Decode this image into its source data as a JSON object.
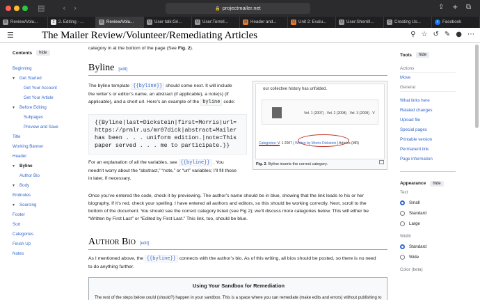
{
  "browser": {
    "url": "projectmailer.net",
    "tabs": [
      {
        "label": "Review/Volu...",
        "favicon": "R",
        "active": false
      },
      {
        "label": "2. Editing - ...",
        "favicon": "2",
        "active": false
      },
      {
        "label": "Review/Volu...",
        "favicon": "R",
        "active": true
      },
      {
        "label": "User talk:Gri...",
        "favicon": "U",
        "active": false
      },
      {
        "label": "User:Terrell...",
        "favicon": "U",
        "active": false
      },
      {
        "label": "Header and...",
        "favicon": "H",
        "active": false
      },
      {
        "label": "Unit 2: Evalu...",
        "favicon": "U",
        "active": false
      },
      {
        "label": "User:SherrilI...",
        "favicon": "U",
        "active": false
      },
      {
        "label": "Creating Us...",
        "favicon": "C",
        "active": false
      },
      {
        "label": "Facebook",
        "favicon": "f",
        "active": false
      }
    ]
  },
  "header": {
    "title_prefix": "The Mailer Review/Volunteer/",
    "title_page": "Remediating Articles"
  },
  "toc": {
    "title": "Contents",
    "hide_label": "hide",
    "items": [
      {
        "label": "Beginning",
        "level": 0
      },
      {
        "label": "Get Started",
        "level": 0,
        "caret": true
      },
      {
        "label": "Get Your Account",
        "level": 2
      },
      {
        "label": "Get Your Article",
        "level": 2
      },
      {
        "label": "Before Editing",
        "level": 0,
        "caret": true
      },
      {
        "label": "Subpages",
        "level": 2
      },
      {
        "label": "Preview and Save",
        "level": 2
      },
      {
        "label": "Title",
        "level": 0
      },
      {
        "label": "Working Banner",
        "level": 0
      },
      {
        "label": "Header",
        "level": 0
      },
      {
        "label": "Byline",
        "level": 0,
        "caret": true,
        "current": true
      },
      {
        "label": "Author Bio",
        "level": 1
      },
      {
        "label": "Body",
        "level": 0,
        "caret": true
      },
      {
        "label": "Endnotes",
        "level": 0
      },
      {
        "label": "Sourcing",
        "level": 0,
        "caret": true
      },
      {
        "label": "Footer",
        "level": 0
      },
      {
        "label": "Sort",
        "level": 0
      },
      {
        "label": "Categories",
        "level": 0
      },
      {
        "label": "Finish Up",
        "level": 0
      },
      {
        "label": "Notes",
        "level": 0
      }
    ]
  },
  "content": {
    "intro_tail_a": "category in at the bottom of the page (See ",
    "intro_tail_fig": "Fig. 2",
    "intro_tail_b": ").",
    "byline_heading": "Byline",
    "edit_label": "[edit]",
    "byline_p1_a": "The byline template ",
    "byline_code": "{{byline}}",
    "byline_p1_b": " should come next. It will include",
    "byline_p1_c": "the writer’s or editor’s name, an abstract (if applicable), a note(s) (if",
    "byline_p1_d": "applicable), and a short url. Here’s an example of the ",
    "byline_plain": "byline",
    "byline_p1_e": " code:",
    "pre_line1": "{{Byline|last=Dickstein|first=Morris|url=",
    "pre_line2": "https://prmlr.us/mr07dick|abstract=Mailer",
    "pre_line3": "has been . . . uniform edition.|note=This",
    "pre_line4": "paper served . . . me to participate.}}",
    "expl_a": "For an explanation of all the variables, see ",
    "expl_b": " . You",
    "expl_c": "needn’t worry about the “abstract,” “note,” or “url” variables; I’ll fill those",
    "expl_d": "in later, if necessary.",
    "once_1": "Once you’ve entered the code, check it by previewing. The author’s name should be in blue, showing that the link leads to his or her",
    "once_2": "biography. If it’s red, check your spelling. I have entered all authors and editors, so this should be working correctly. Next, scroll to the",
    "once_3": "bottom of the document. You should see the correct category listed (see Fig 2); we’ll discuss more categories below. This will either be",
    "once_4": "“Written by First Last” or “Edited by First Last.” This link, too, should be blue.",
    "bio_heading": "Author Bio",
    "bio_1a": "As I mentioned above, the ",
    "bio_1b": " connects with the author’s bio. As of this writing, all bios should be posted, so there is no need",
    "bio_2": "to do anything further.",
    "sandbox_title": "Using Your Sandbox for Remediation",
    "sandbox_text": "The rest of the steps below could (should?) happen in your sandbox. This is a space where you can remediate (make edits and errors) without publishing to"
  },
  "figure": {
    "top_text": "our collective history has unfolded.",
    "vols": "Vol. 1 (2007) · Vol. 2 (2008) · Vol. 3 (2009) · V",
    "cats_label": "Categories",
    "cats_rest": ":  V. 1 2007  |",
    "cats_written": "Written by Morris Dickstein",
    "cats_tail": "| Articles (MR)",
    "caption_fig": "Fig. 2",
    "caption_text": ". Byline inserts the correct category."
  },
  "tools": {
    "title": "Tools",
    "hide_label": "hide",
    "actions_label": "Actions",
    "move": "Move",
    "general_label": "General",
    "links": [
      "What links here",
      "Related changes",
      "Upload file",
      "Special pages",
      "Printable version",
      "Permanent link",
      "Page information"
    ]
  },
  "appearance": {
    "title": "Appearance",
    "hide_label": "hide",
    "text_label": "Text",
    "text_options": [
      "Small",
      "Standard",
      "Large"
    ],
    "text_selected": 0,
    "width_label": "Width",
    "width_options": [
      "Standard",
      "Wide"
    ],
    "width_selected": 0,
    "color_label": "Color (beta)"
  },
  "colors": {
    "link": "#3366cc",
    "annotation_red": "#c0392b"
  }
}
